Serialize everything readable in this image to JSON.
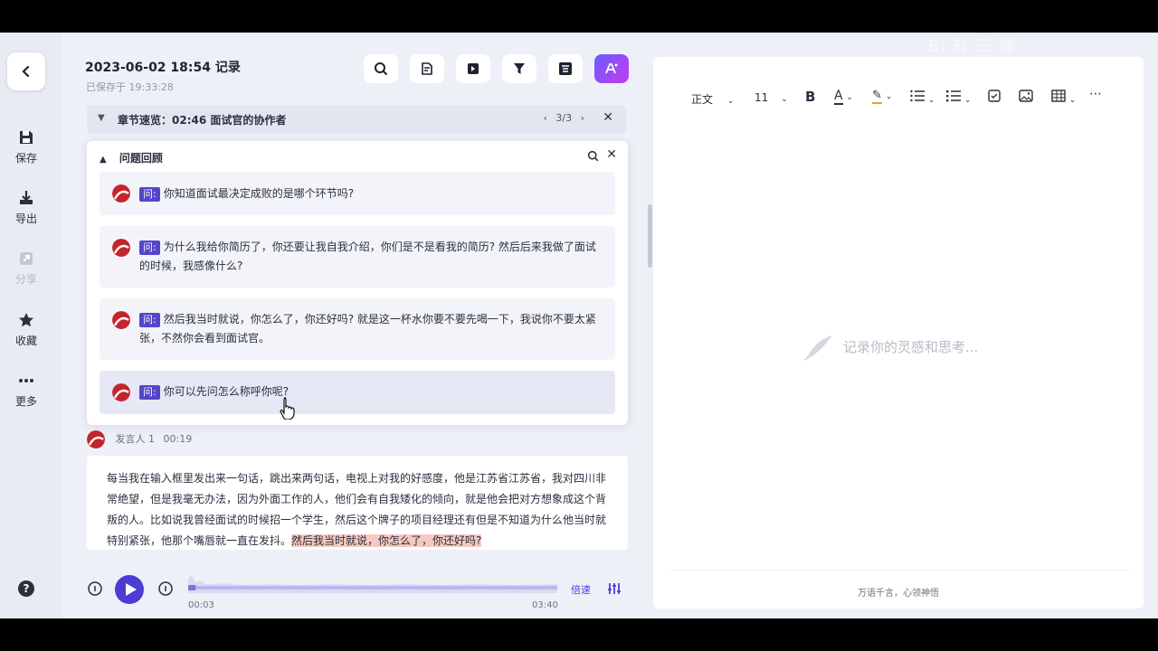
{
  "nav": {
    "save": "保存",
    "export": "导出",
    "share": "分享",
    "favorite": "收藏",
    "more": "更多"
  },
  "header": {
    "title": "2023-06-02 18:54 记录",
    "saved": "已保存于 19:33:28"
  },
  "chapter": {
    "label": "章节速览：02:46 面试官的协作者",
    "pager": "3/3"
  },
  "qa": {
    "title": "问题回顾",
    "tag": "问:",
    "items": [
      "你知道面试最决定成败的是哪个环节吗?",
      "为什么我给你简历了，你还要让我自我介绍，你们是不是看我的简历? 然后后来我做了面试的时候，我感像什么?",
      "然后我当时就说，你怎么了，你还好吗? 就是这一杯水你要不要先喝一下，我说你不要太紧张，不然你会看到面试官。",
      "你可以先问怎么称呼你呢?"
    ]
  },
  "speaker": {
    "name": "发言人 1",
    "time": "00:19"
  },
  "transcript": {
    "text": "每当我在输入框里发出来一句话，跳出来两句话，电视上对我的好感度，他是江苏省江苏省，我对四川非常绝望，但是我毫无办法，因为外面工作的人，他们会有自我矮化的倾向，就是他会把对方想象成这个背叛的人。比如说我曾经面试的时候招一个学生，然后这个牌子的项目经理还有但是不知道为什么他当时就特别紧张，他那个嘴唇就一直在发抖。",
    "highlight": "然后我当时就说，你怎么了，你还好吗?"
  },
  "player": {
    "current": "00:03",
    "total": "03:40",
    "speed": "倍速",
    "progress": 0.02
  },
  "editor": {
    "style": "正文",
    "size": "11",
    "placeholder": "记录你的灵感和思考...",
    "footer": "万语千言，心领神悟"
  },
  "watermark": "Bi 有 三 播",
  "colors": {
    "accent": "#4b3cd6",
    "highlight": "#f6c9c0"
  }
}
